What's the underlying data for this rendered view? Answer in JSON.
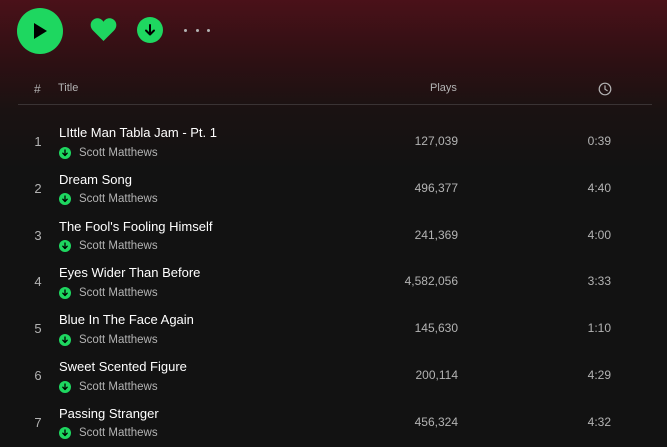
{
  "colors": {
    "accent": "#1ed760",
    "background": "#121212",
    "header_tint": "#4a1119",
    "muted_text": "#b3b3b3"
  },
  "action_bar": {
    "play_icon": "play-icon",
    "like_icon": "heart-icon",
    "download_icon": "download-icon",
    "more_icon": "more-icon"
  },
  "table": {
    "header": {
      "number": "#",
      "title": "Title",
      "plays": "Plays",
      "duration_icon": "clock-icon"
    },
    "tracks": [
      {
        "number": "1",
        "title": "LIttle Man Tabla Jam - Pt. 1",
        "artist": "Scott Matthews",
        "plays": "127,039",
        "duration": "0:39"
      },
      {
        "number": "2",
        "title": "Dream Song",
        "artist": "Scott Matthews",
        "plays": "496,377",
        "duration": "4:40"
      },
      {
        "number": "3",
        "title": "The Fool's Fooling Himself",
        "artist": "Scott Matthews",
        "plays": "241,369",
        "duration": "4:00"
      },
      {
        "number": "4",
        "title": "Eyes Wider Than Before",
        "artist": "Scott Matthews",
        "plays": "4,582,056",
        "duration": "3:33"
      },
      {
        "number": "5",
        "title": "Blue In The Face Again",
        "artist": "Scott Matthews",
        "plays": "145,630",
        "duration": "1:10"
      },
      {
        "number": "6",
        "title": "Sweet Scented Figure",
        "artist": "Scott Matthews",
        "plays": "200,114",
        "duration": "4:29"
      },
      {
        "number": "7",
        "title": "Passing Stranger",
        "artist": "Scott Matthews",
        "plays": "456,324",
        "duration": "4:32"
      }
    ]
  }
}
